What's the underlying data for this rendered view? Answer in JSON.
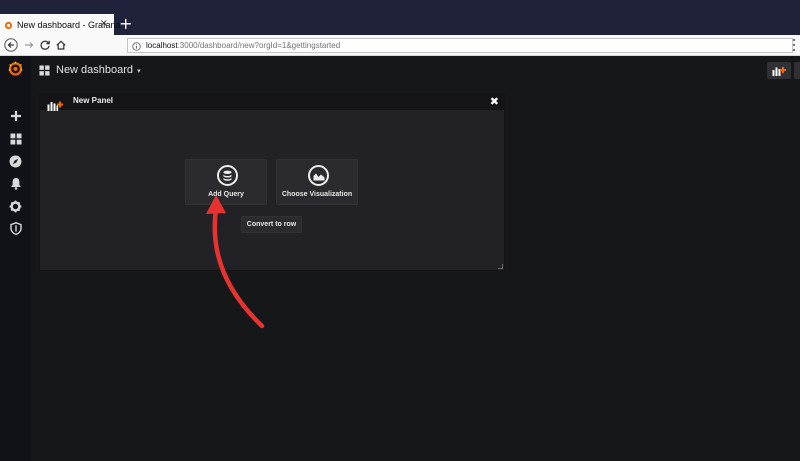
{
  "browser": {
    "tab_title": "New dashboard - Grafana",
    "tab_close": "×",
    "new_tab": "+",
    "url_host": "localhost",
    "url_rest": ":3000/dashboard/new?orgId=1&gettingstarted"
  },
  "sidemenu": {
    "items": [
      {
        "icon": "plus-icon"
      },
      {
        "icon": "dashboards-grid-icon"
      },
      {
        "icon": "explore-compass-icon"
      },
      {
        "icon": "alerting-bell-icon"
      },
      {
        "icon": "configuration-gear-icon"
      },
      {
        "icon": "server-admin-shield-icon"
      }
    ]
  },
  "topbar": {
    "dashboard_title": "New dashboard",
    "caret": "▾"
  },
  "panel": {
    "title": "New Panel",
    "close": "✖",
    "add_query_label": "Add Query",
    "choose_visualization_label": "Choose Visualization",
    "convert_to_row_label": "Convert to row"
  },
  "colors": {
    "background": "#161719",
    "panel": "#222226",
    "grafana_orange": "#f46800",
    "annotation_arrow": "#e8322f"
  }
}
